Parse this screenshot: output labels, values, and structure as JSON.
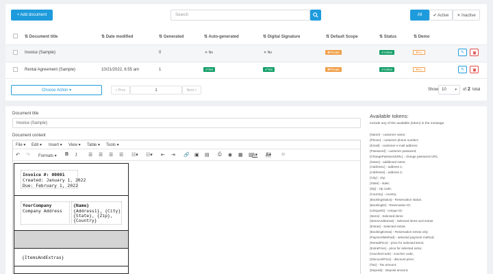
{
  "toolbar": {
    "add_document": "+ Add document",
    "search_placeholder": "Search",
    "filter_all": "All",
    "filter_active": "✔ Active",
    "filter_inactive": "✕ Inactive"
  },
  "table": {
    "headers": [
      "Document title",
      "Date modified",
      "Generated",
      "Auto-generated",
      "Digital Signature",
      "Default Scope",
      "Status",
      "Demo"
    ],
    "rows": [
      {
        "title": "Invoice (Sample)",
        "date": "",
        "generated": "0",
        "auto": "No",
        "signature": "No",
        "scope": "Private",
        "status": "Active",
        "demo": "No"
      },
      {
        "title": "Rental Agreement (Sample)",
        "date": "10/21/2022, 6:55 am",
        "generated": "1",
        "auto": "Yes",
        "signature": "Yes",
        "scope": "Private",
        "status": "Active",
        "demo": "No"
      }
    ]
  },
  "pagination": {
    "choose_action": "Choose Action ▾",
    "prev": "« Prev",
    "page": "1",
    "next": "Next »",
    "show_label": "Show",
    "per_page": "10",
    "of_label": "of",
    "total_pages": "2",
    "total_label": "total"
  },
  "editor": {
    "title_label": "Document title",
    "title_value": "Invoice (Sample)",
    "content_label": "Document content",
    "menus": [
      "File",
      "Edit",
      "Insert",
      "View",
      "Table",
      "Tools"
    ],
    "formats_label": "Formats",
    "invoice_line": "Invoice #: 00001",
    "created_line": "Created: January 1, 2022",
    "due_line": "Due: February 1, 2022",
    "company_name": "YourCompany",
    "company_address": "Company Address",
    "customer_name": "{Name}",
    "customer_line2": "{Address1}, {City}",
    "customer_line3": "{State}, {Zip},",
    "customer_line4": "{Country}",
    "items_token": "{ItemsAndExtras}"
  },
  "tokens": {
    "title": "Available tokens:",
    "subtitle": "Include any of the available (token) in the message.",
    "items": [
      "{Name} - customer name;",
      "{Phone} - customer phone number;",
      "{Email} - customer e-mail address;",
      "{Password} - customer password;",
      "{ChangePasswordURL} - change password URL;",
      "{Notes} - additional notes;",
      "{Address1} - address 1;",
      "{Address2} - address 2;",
      "{City} - city;",
      "{State} - state;",
      "{Zip} - zip code;",
      "{Country} - country;",
      "{BookingStatus} - Reservation status;",
      "{BookingID} - Reservation ID;",
      "{UniqueID} - Unique ID;",
      "{Items} - Selected items",
      "{ItemsAndExtras} - Selected items and extras",
      "{Extras} - Selected extras",
      "{BookingExtras} - Reservation extras only",
      "{PaymentMethod} - selected payment method;",
      "{RentalPrice} - price for selected items;",
      "{ExtraPrice} - price for selected extra;",
      "{VoucherCode} - voucher code;",
      "{DiscountPrice} - discount price;",
      "{Tax} - Tax amount;",
      "{Deposit} - Deposit amount;"
    ]
  },
  "colors": {
    "accent": "#1e9bdc",
    "success": "#17a06b",
    "warning": "#f0a04b",
    "danger": "#e04b4b"
  }
}
